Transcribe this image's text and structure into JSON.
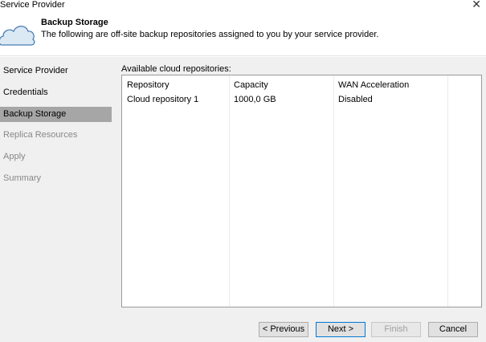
{
  "window": {
    "title": "Service Provider",
    "close_glyph": "✕"
  },
  "header": {
    "title": "Backup Storage",
    "description": "The following are off-site backup repositories assigned to you by your service provider.",
    "icon": "cloud-icon"
  },
  "nav": {
    "items": [
      {
        "label": "Service Provider",
        "state": "done"
      },
      {
        "label": "Credentials",
        "state": "done"
      },
      {
        "label": "Backup Storage",
        "state": "selected"
      },
      {
        "label": "Replica Resources",
        "state": "inactive"
      },
      {
        "label": "Apply",
        "state": "inactive"
      },
      {
        "label": "Summary",
        "state": "inactive"
      }
    ]
  },
  "main": {
    "list_label": "Available cloud repositories:",
    "columns": [
      "Repository",
      "Capacity",
      "WAN Acceleration"
    ],
    "rows": [
      [
        "Cloud repository 1",
        "1000,0 GB",
        "Disabled"
      ]
    ]
  },
  "footer": {
    "previous_label": "< Previous",
    "next_label": "Next >",
    "finish_label": "Finish",
    "cancel_label": "Cancel"
  },
  "colors": {
    "selected_nav": "#a6a6a6",
    "panel_bg": "#f0f0f0",
    "primary_border": "#0078d7"
  }
}
